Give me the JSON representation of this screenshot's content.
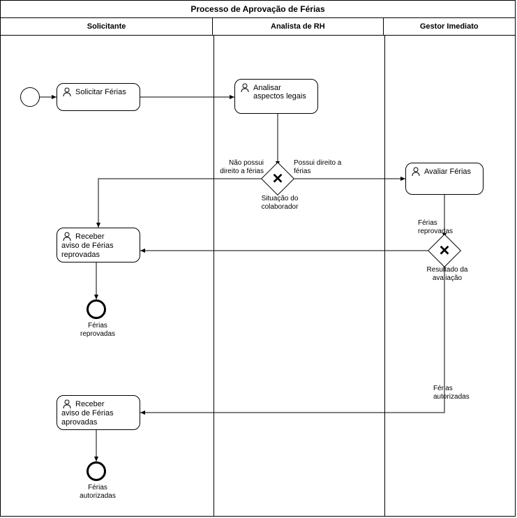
{
  "pool_title": "Processo de Aprovação de Férias",
  "lanes": {
    "l1": "Solicitante",
    "l2": "Analista de RH",
    "l3": "Gestor Imediato"
  },
  "tasks": {
    "t1": "Solicitar Férias",
    "t2": "Analisar aspectos legais",
    "t3": "Avaliar Férias",
    "t4_l1": "Receber",
    "t4_l2": "aviso de Férias",
    "t4_l3": "reprovadas",
    "t5_l1": "Receber",
    "t5_l2": "aviso de Férias",
    "t5_l3": "aprovadas"
  },
  "gateways": {
    "g1_label": "Situação do colaborador",
    "g2_label": "Resultado da avaliação"
  },
  "flow_labels": {
    "g1_no": "Não possui direito a férias",
    "g1_yes": "Possui direito a férias",
    "g2_rep": "Férias reprovadas",
    "g2_aut": "Férias autorizadas"
  },
  "end_labels": {
    "e1": "Férias reprovadas",
    "e2": "Férias autorizadas"
  }
}
